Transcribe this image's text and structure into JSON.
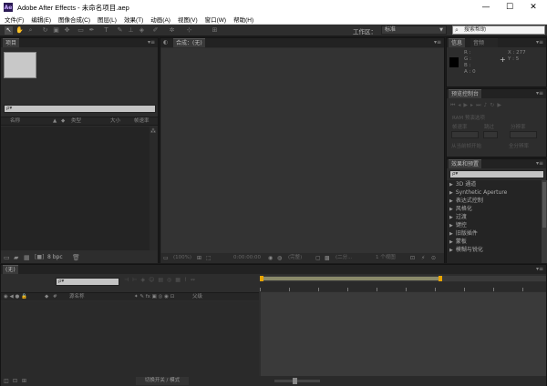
{
  "window": {
    "title": "Adobe After Effects - 未命名项目.aep",
    "logo_text": "Ae",
    "minimize_glyph": "—",
    "maximize_glyph": "☐",
    "close_glyph": "✕"
  },
  "menu": [
    "文件(F)",
    "编辑(E)",
    "图像合成(C)",
    "图层(L)",
    "效果(T)",
    "动画(A)",
    "视图(V)",
    "窗口(W)",
    "帮助(H)"
  ],
  "toolbar": {
    "workspace_label": "工作区：",
    "workspace_value": "标准",
    "search_placeholder": "搜索帮助"
  },
  "project_panel": {
    "tab": "项目",
    "search_placeholder": "ρ▾",
    "col_name": "名称",
    "col_type": "类型",
    "col_size": "大小",
    "col_frame_rate": "帧速率",
    "bpc_label": "8 bpc"
  },
  "composition_panel": {
    "tab": "合成：(无)",
    "zoom": "(100%)",
    "timecode": "0:00:00:00",
    "quality": "(完整)",
    "view": "(二分...",
    "view_layout": "1 个视图"
  },
  "info_panel": {
    "tab_info": "信息",
    "tab_audio": "音频",
    "r_label": "R :",
    "g_label": "G :",
    "b_label": "B :",
    "a_label": "A :",
    "a_value": "0",
    "x_label": "X : 277",
    "y_label": "Y : 5",
    "cursor_glyph": "+",
    "swatch_color": "#000000"
  },
  "preview_panel": {
    "tab": "预览控制台",
    "ram_preview": "RAM 预演选项",
    "frame_rate_label": "帧速率",
    "skip_label": "跳过",
    "resolution_label": "分辨率",
    "from_current": "从当前帧开始",
    "full_screen": "全分辨率"
  },
  "effects_panel": {
    "tab": "效果和预置",
    "search_placeholder": "ρ▾",
    "items": [
      "3D 通道",
      "Synthetic Aperture",
      "表达式控制",
      "风格化",
      "过渡",
      "键控",
      "旧版插件",
      "蒙板",
      "模糊与锐化"
    ]
  },
  "timeline": {
    "tab": "(无)",
    "search_placeholder": "ρ▾",
    "col_source_name": "源名称",
    "col_parent": "父级",
    "footer_toggle": "切换开关 / 模式"
  },
  "colors": {
    "accent_orange": "#e8a400",
    "panel_bg": "#2d2d2d",
    "dark_bg": "#242424"
  }
}
